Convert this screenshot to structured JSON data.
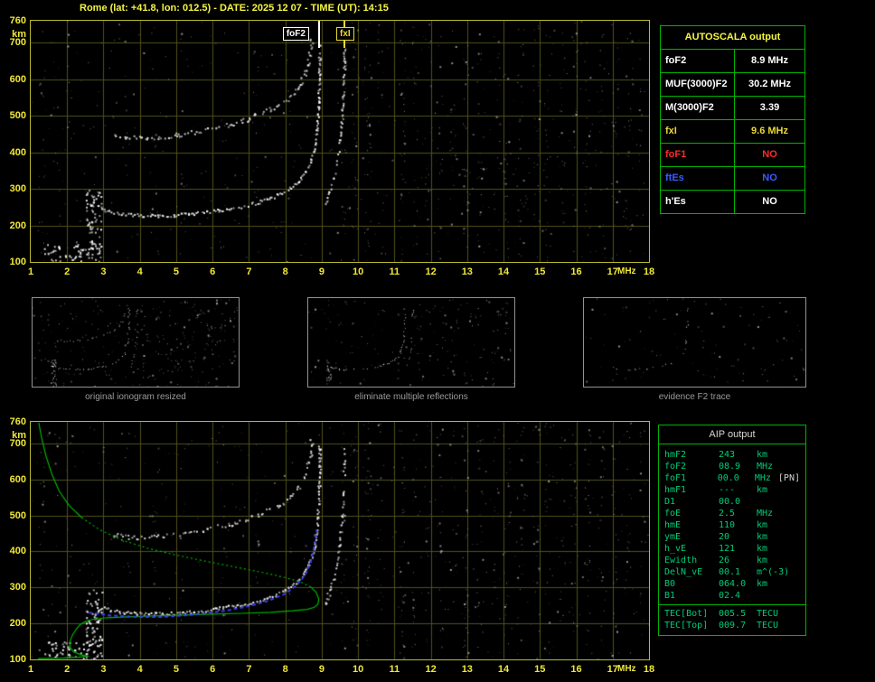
{
  "title": "Rome (lat: +41.8, lon: 012.5) - DATE: 2025 12 07 - TIME (UT): 14:15",
  "axes": {
    "x_range": [
      1,
      18
    ],
    "y_range": [
      100,
      760
    ],
    "x_ticks": [
      1,
      2,
      3,
      4,
      5,
      6,
      7,
      8,
      9,
      10,
      11,
      12,
      13,
      14,
      15,
      16,
      17,
      18
    ],
    "y_ticks": [
      760,
      700,
      600,
      500,
      400,
      300,
      200,
      100
    ],
    "x_unit": "MHz",
    "y_unit": "km"
  },
  "plot_markers": [
    {
      "label": "foF2",
      "freq": 8.9,
      "color": "#ffffff",
      "side": "left"
    },
    {
      "label": "fxI",
      "freq": 9.6,
      "color": "#e8d835",
      "side": "right"
    }
  ],
  "autoscala_table": {
    "header": "AUTOSCALA output",
    "rows": [
      {
        "label": "foF2",
        "value": "8.9 MHz",
        "color": "#ffffff"
      },
      {
        "label": "MUF(3000)F2",
        "value": "30.2 MHz",
        "color": "#ffffff"
      },
      {
        "label": "M(3000)F2",
        "value": "3.39",
        "color": "#ffffff"
      },
      {
        "label": "fxI",
        "value": "9.6 MHz",
        "color": "#e8d835"
      },
      {
        "label": "foF1",
        "value": "NO",
        "color": "#ff2a2a"
      },
      {
        "label": "ftEs",
        "value": "NO",
        "color": "#3b5bff"
      },
      {
        "label": "h'Es",
        "value": "NO",
        "color": "#ffffff"
      }
    ]
  },
  "aip_table": {
    "header": "AIP output",
    "rows": [
      {
        "label": "hmF2",
        "value": "243",
        "unit": "km",
        "extra": ""
      },
      {
        "label": "foF2",
        "value": "08.9",
        "unit": "MHz",
        "extra": ""
      },
      {
        "label": "foF1",
        "value": "00.0",
        "unit": "MHz",
        "extra": "[PN]"
      },
      {
        "label": "hmF1",
        "value": "---",
        "unit": "km",
        "extra": ""
      },
      {
        "label": "D1",
        "value": "00.0",
        "unit": "",
        "extra": ""
      },
      {
        "label": "foE",
        "value": "2.5",
        "unit": "MHz",
        "extra": ""
      },
      {
        "label": "hmE",
        "value": "110",
        "unit": "km",
        "extra": ""
      },
      {
        "label": "ymE",
        "value": "20",
        "unit": "km",
        "extra": ""
      },
      {
        "label": "h_vE",
        "value": "121",
        "unit": "km",
        "extra": ""
      },
      {
        "label": "Ewidth",
        "value": "26",
        "unit": "km",
        "extra": ""
      },
      {
        "label": "DelN_vE",
        "value": "00.1",
        "unit": "m^(-3)",
        "extra": ""
      },
      {
        "label": "B0",
        "value": "064.0",
        "unit": "km",
        "extra": ""
      },
      {
        "label": "B1",
        "value": "02.4",
        "unit": "",
        "extra": ""
      }
    ],
    "tec_rows": [
      {
        "label": "TEC[Bot]",
        "value": "005.5",
        "unit": "TECU"
      },
      {
        "label": "TEC[Top]",
        "value": "009.7",
        "unit": "TECU"
      }
    ]
  },
  "thumbnails": [
    {
      "caption": "original ionogram resized"
    },
    {
      "caption": "eliminate multiple reflections"
    },
    {
      "caption": "evidence F2 trace"
    }
  ],
  "colors": {
    "grid": "#50501a",
    "noise": "#d7d7d7",
    "green_profile": "#00b400",
    "blue_trace": "#3c3cf0"
  },
  "drawing": {
    "stripes": [
      [
        1.3,
        0.35
      ],
      [
        1.7,
        0.2
      ],
      [
        2.05,
        0.2
      ],
      [
        3.6,
        0.2
      ],
      [
        4.4,
        0.25
      ],
      [
        5.2,
        0.2
      ],
      [
        6.3,
        0.2
      ],
      [
        7.2,
        0.2
      ],
      [
        8.1,
        0.15
      ],
      [
        9.6,
        0.3
      ],
      [
        9.9,
        0.5
      ],
      [
        10.25,
        0.85
      ],
      [
        10.6,
        0.35
      ],
      [
        11.2,
        0.75
      ],
      [
        11.55,
        0.45
      ],
      [
        11.9,
        0.3
      ],
      [
        12.25,
        0.4
      ],
      [
        12.6,
        0.3
      ],
      [
        12.95,
        0.65
      ],
      [
        13.35,
        0.5
      ],
      [
        13.8,
        0.35
      ],
      [
        14.1,
        0.4
      ],
      [
        14.45,
        0.55
      ],
      [
        14.9,
        0.45
      ],
      [
        15.2,
        0.5
      ],
      [
        15.6,
        0.4
      ],
      [
        15.95,
        0.45
      ],
      [
        16.3,
        0.6
      ],
      [
        16.7,
        0.4
      ],
      [
        17.05,
        0.45
      ],
      [
        17.45,
        0.4
      ],
      [
        17.8,
        0.35
      ]
    ],
    "traces": {
      "second_hop": [
        [
          3.2,
          448
        ],
        [
          3.6,
          443
        ],
        [
          4.0,
          441
        ],
        [
          4.5,
          443
        ],
        [
          5.0,
          449
        ],
        [
          5.5,
          456
        ],
        [
          6.0,
          466
        ],
        [
          6.5,
          478
        ],
        [
          7.0,
          494
        ],
        [
          7.5,
          514
        ],
        [
          7.9,
          536
        ],
        [
          8.2,
          560
        ],
        [
          8.45,
          595
        ],
        [
          8.6,
          640
        ],
        [
          8.7,
          690
        ],
        [
          8.72,
          720
        ]
      ],
      "main_f2": [
        [
          2.95,
          245
        ],
        [
          3.2,
          238
        ],
        [
          3.6,
          232
        ],
        [
          4.0,
          229
        ],
        [
          4.5,
          228
        ],
        [
          5.0,
          230
        ],
        [
          5.5,
          234
        ],
        [
          6.0,
          240
        ],
        [
          6.5,
          248
        ],
        [
          7.0,
          258
        ],
        [
          7.4,
          270
        ],
        [
          7.8,
          285
        ],
        [
          8.1,
          302
        ],
        [
          8.35,
          322
        ],
        [
          8.55,
          348
        ],
        [
          8.7,
          380
        ],
        [
          8.8,
          420
        ],
        [
          8.86,
          470
        ],
        [
          8.9,
          530
        ],
        [
          8.92,
          600
        ],
        [
          8.93,
          670
        ],
        [
          8.93,
          700
        ]
      ],
      "x_mode": [
        [
          9.05,
          250
        ],
        [
          9.15,
          275
        ],
        [
          9.25,
          305
        ],
        [
          9.35,
          345
        ],
        [
          9.45,
          400
        ],
        [
          9.52,
          460
        ],
        [
          9.57,
          530
        ],
        [
          9.6,
          610
        ],
        [
          9.62,
          690
        ]
      ]
    },
    "blobs": {
      "e_blob": {
        "f_min": 2.5,
        "f_max": 2.95,
        "km_min": 100,
        "km_max": 300,
        "count": 80
      },
      "e_low": {
        "f_min": 1.35,
        "f_max": 2.6,
        "km_min": 104,
        "km_max": 150,
        "count": 45
      }
    },
    "green_profile": {
      "segments": [
        {
          "dash": [],
          "pts": [
            [
              1.22,
              758
            ],
            [
              1.3,
              715
            ],
            [
              1.42,
              665
            ],
            [
              1.58,
              615
            ],
            [
              1.78,
              568
            ],
            [
              2.05,
              528
            ],
            [
              2.4,
              494
            ]
          ]
        },
        {
          "dash": [
            2,
            3
          ],
          "pts": [
            [
              2.4,
              494
            ],
            [
              2.9,
              460
            ],
            [
              3.5,
              432
            ],
            [
              4.2,
              409
            ],
            [
              5.0,
              390
            ],
            [
              5.8,
              373
            ],
            [
              6.6,
              357
            ],
            [
              7.3,
              343
            ],
            [
              7.9,
              330
            ],
            [
              8.4,
              316
            ],
            [
              8.7,
              301
            ]
          ]
        },
        {
          "dash": [],
          "pts": [
            [
              8.7,
              301
            ],
            [
              8.85,
              286
            ],
            [
              8.92,
              268
            ],
            [
              8.9,
              254
            ],
            [
              8.8,
              245
            ],
            [
              8.6,
              239
            ],
            [
              8.2,
              235
            ],
            [
              7.6,
              231
            ],
            [
              6.8,
              228
            ],
            [
              5.8,
              225
            ],
            [
              4.8,
              222
            ],
            [
              3.8,
              219
            ],
            [
              3.1,
              216
            ],
            [
              2.7,
              211
            ],
            [
              2.5,
              205
            ],
            [
              2.35,
              196
            ],
            [
              2.25,
              184
            ],
            [
              2.15,
              168
            ],
            [
              2.08,
              150
            ],
            [
              2.08,
              134
            ],
            [
              2.18,
              121
            ],
            [
              2.38,
              113
            ],
            [
              2.55,
              109
            ],
            [
              2.3,
              106
            ],
            [
              1.9,
              104
            ],
            [
              1.5,
              103
            ],
            [
              1.2,
              102
            ]
          ]
        }
      ]
    },
    "blue_trace": {
      "dash": [
        4,
        3
      ],
      "pts": [
        [
          2.6,
          230
        ],
        [
          3.2,
          222
        ],
        [
          3.9,
          218
        ],
        [
          4.6,
          218
        ],
        [
          5.2,
          222
        ],
        [
          5.8,
          228
        ],
        [
          6.4,
          236
        ],
        [
          7.0,
          248
        ],
        [
          7.5,
          262
        ],
        [
          8.0,
          282
        ],
        [
          8.3,
          305
        ],
        [
          8.55,
          335
        ],
        [
          8.7,
          370
        ],
        [
          8.8,
          415
        ],
        [
          8.87,
          460
        ]
      ]
    }
  }
}
